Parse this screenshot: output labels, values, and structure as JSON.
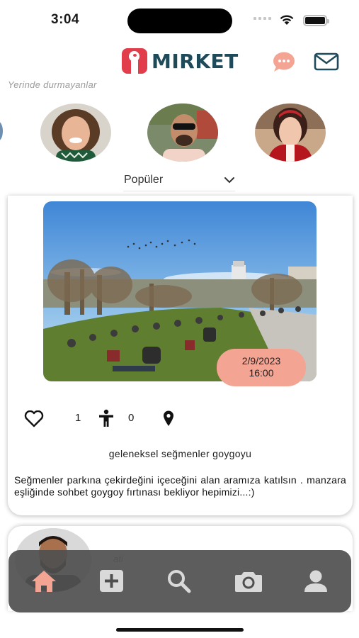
{
  "status_bar": {
    "time": "3:04"
  },
  "header": {
    "logo_text": "MIRKET"
  },
  "tagline": "Yerinde durmayanlar",
  "stories": [
    {
      "icon": "avatar-woman-curly-hair"
    },
    {
      "icon": "avatar-man-sunglasses"
    },
    {
      "icon": "avatar-woman-red-scarf"
    }
  ],
  "sort": {
    "selected": "Popüler"
  },
  "post": {
    "date": "2/9/2023",
    "time": "16:00",
    "likes": "1",
    "joins": "0",
    "title": "geleneksel seğmenler goygoyu",
    "body": "Seğmenler parkına çekirdeğini içeceğini alan aramıza katılsın . manzara eşliğinde sohbet goygoy fırtınası bekliyor hepimizi...:)"
  },
  "next_post": {
    "username": "ati"
  },
  "tabs": [
    {
      "name": "home",
      "icon": "home-icon",
      "active": true
    },
    {
      "name": "add",
      "icon": "plus-square-icon"
    },
    {
      "name": "search",
      "icon": "search-icon"
    },
    {
      "name": "camera",
      "icon": "camera-icon"
    },
    {
      "name": "profile",
      "icon": "user-icon"
    }
  ],
  "colors": {
    "accent": "#f4a493",
    "brand": "#1f4a5a",
    "logo_red": "#e23d4b",
    "tab_bar": "#4f4f4f",
    "tab_active": "#f4a493",
    "tab_inactive": "#d9d9d9"
  }
}
